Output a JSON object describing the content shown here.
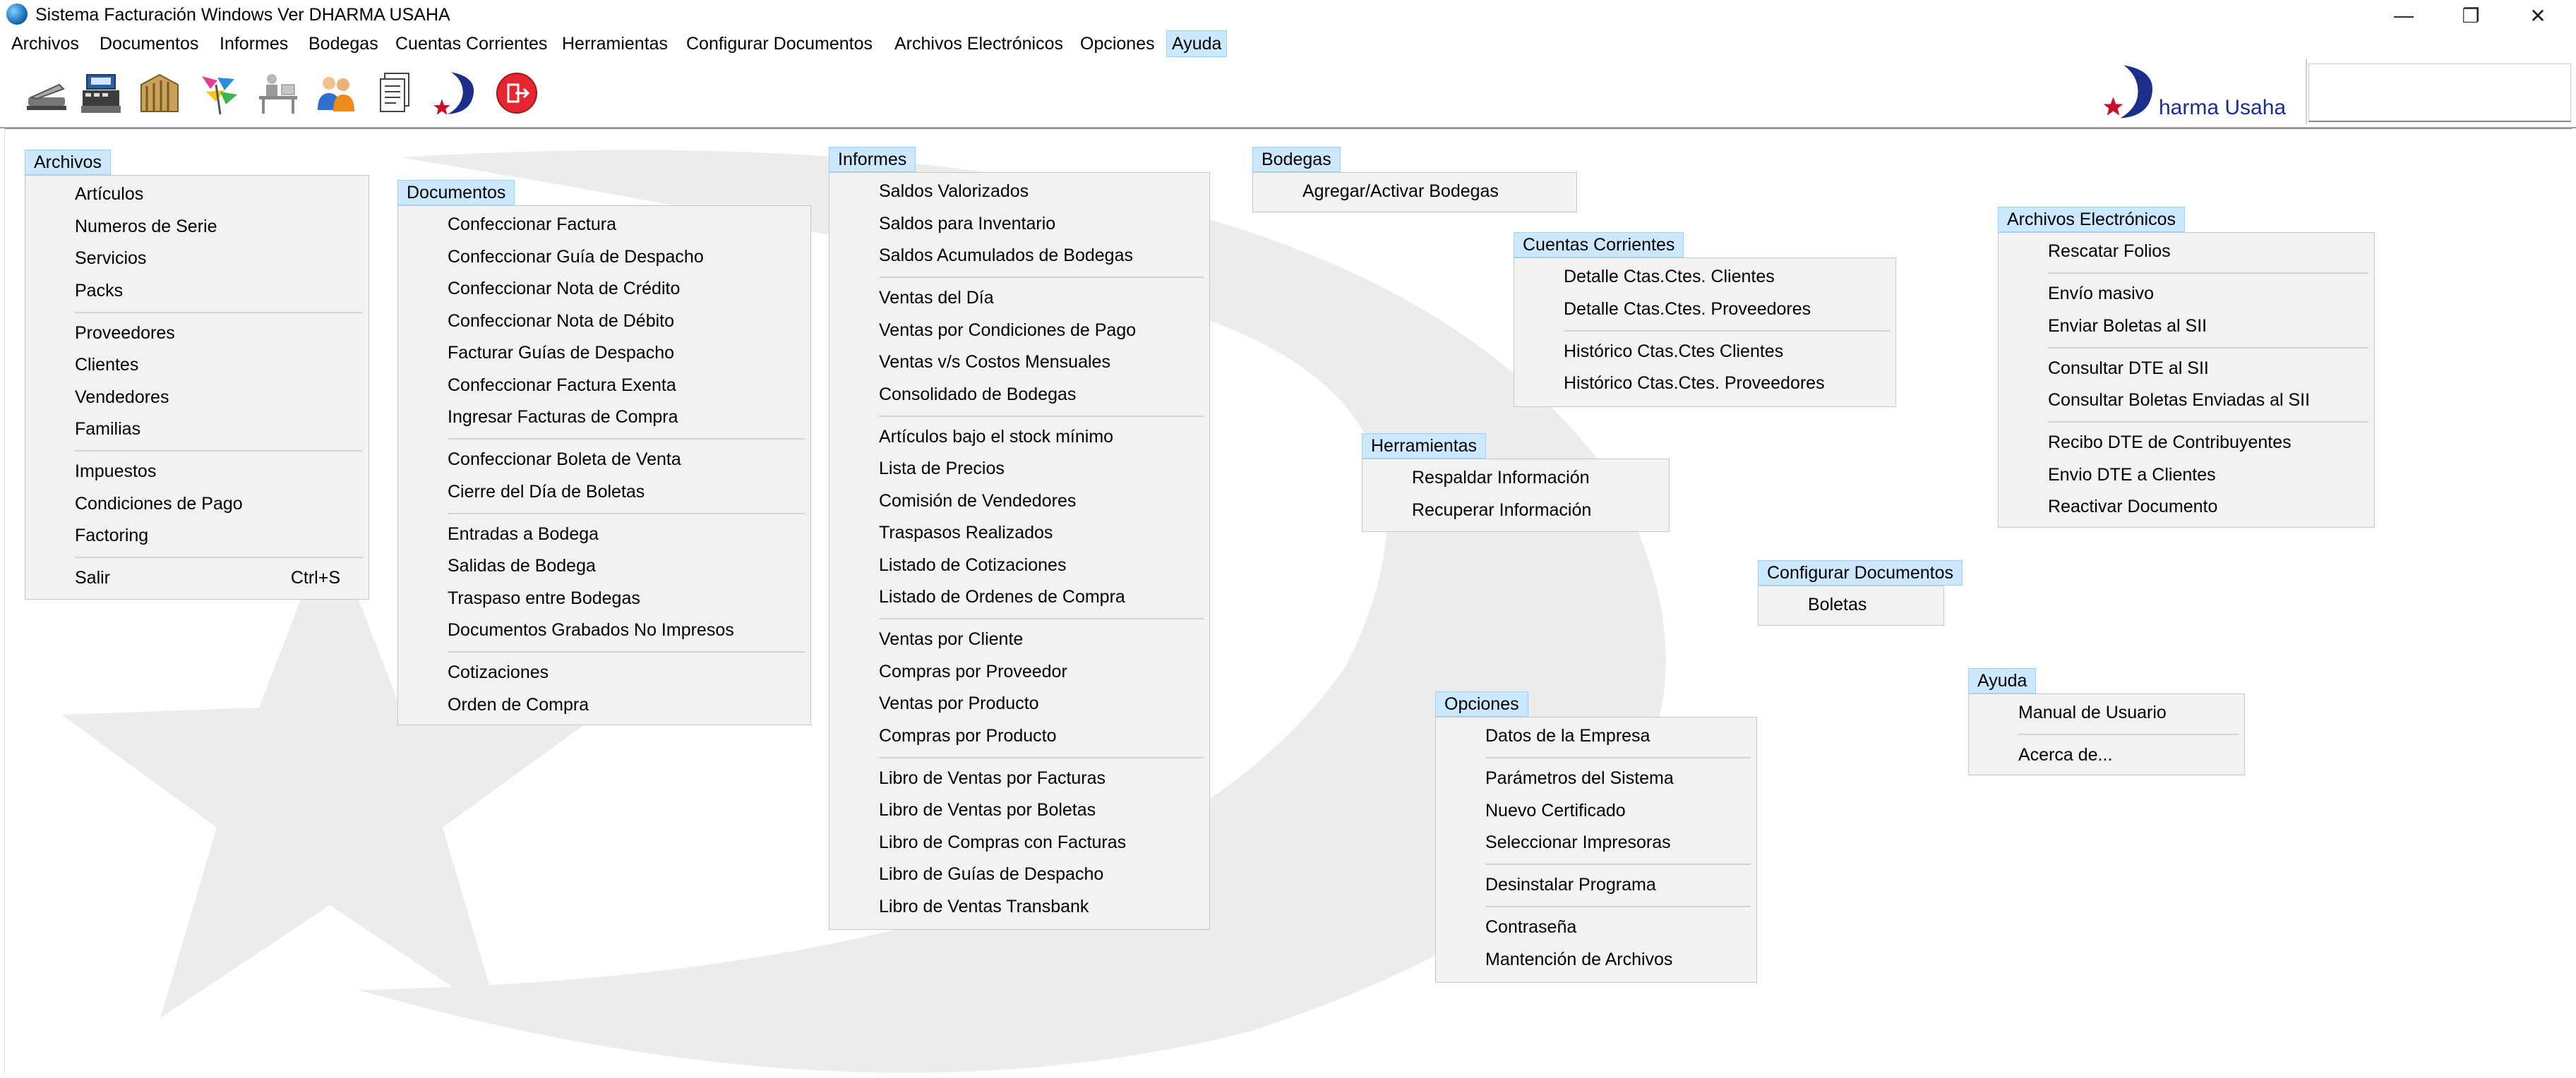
{
  "window": {
    "title": "Sistema Facturación Windows Ver DHARMA USAHA",
    "minimize_glyph": "—",
    "restore_glyph": "❐",
    "close_glyph": "✕"
  },
  "menubar": [
    "Archivos",
    "Documentos",
    "Informes",
    "Bodegas",
    "Cuentas Corrientes",
    "Herramientas",
    "Configurar Documentos",
    "Archivos Electrónicos",
    "Opciones",
    "Ayuda"
  ],
  "toolbar": {
    "icons": [
      "stapler-icon",
      "cash-register-icon",
      "warehouse-icon",
      "flags-icon",
      "desk-worker-icon",
      "users-icon",
      "documents-icon",
      "dharma-logo-icon",
      "exit-icon"
    ],
    "logo_text": "harma Usaha"
  },
  "menus": {
    "archivos": {
      "title": "Archivos",
      "items": [
        "Artículos",
        "Numeros de Serie",
        "Servicios",
        "Packs",
        "Proveedores",
        "Clientes",
        "Vendedores",
        "Familias",
        "Impuestos",
        "Condiciones de Pago",
        "Factoring",
        "Salir"
      ],
      "shortcut": "Ctrl+S"
    },
    "documentos": {
      "title": "Documentos",
      "items": [
        "Confeccionar Factura",
        "Confeccionar Guía de Despacho",
        "Confeccionar Nota de Crédito",
        "Confeccionar Nota de Débito",
        "Facturar Guías de Despacho",
        "Confeccionar Factura Exenta",
        "Ingresar Facturas de Compra",
        "Confeccionar Boleta de Venta",
        "Cierre del Día de Boletas",
        "Entradas a Bodega",
        "Salidas de Bodega",
        "Traspaso entre Bodegas",
        "Documentos Grabados No Impresos",
        "Cotizaciones",
        "Orden de Compra"
      ]
    },
    "informes": {
      "title": "Informes",
      "items": [
        "Saldos Valorizados",
        "Saldos para Inventario",
        "Saldos Acumulados de Bodegas",
        "Ventas del Día",
        "Ventas por Condiciones de Pago",
        "Ventas v/s Costos Mensuales",
        "Consolidado de Bodegas",
        "Artículos bajo el stock mínimo",
        "Lista de Precios",
        "Comisión de Vendedores",
        "Traspasos Realizados",
        "Listado de Cotizaciones",
        "Listado de Ordenes de Compra",
        "Ventas por Cliente",
        "Compras por Proveedor",
        "Ventas por Producto",
        "Compras por Producto",
        "Libro de Ventas por Facturas",
        "Libro de Ventas por Boletas",
        "Libro de Compras con Facturas",
        "Libro de Guías de Despacho",
        "Libro de Ventas Transbank"
      ]
    },
    "bodegas": {
      "title": "Bodegas",
      "items": [
        "Agregar/Activar Bodegas"
      ]
    },
    "cuentas": {
      "title": "Cuentas Corrientes",
      "items": [
        "Detalle Ctas.Ctes. Clientes",
        "Detalle Ctas.Ctes. Proveedores",
        "Histórico Ctas.Ctes Clientes",
        "Histórico Ctas.Ctes. Proveedores"
      ]
    },
    "herramientas": {
      "title": "Herramientas",
      "items": [
        "Respaldar Información",
        "Recuperar Información"
      ]
    },
    "configurar": {
      "title": "Configurar Documentos",
      "items": [
        "Boletas"
      ]
    },
    "electronicos": {
      "title": "Archivos Electrónicos",
      "items": [
        "Rescatar Folios",
        "Envío masivo",
        "Enviar Boletas al SII",
        "Consultar DTE al SII",
        "Consultar Boletas Enviadas al SII",
        "Recibo DTE de  Contribuyentes",
        "Envio DTE a Clientes",
        "Reactivar Documento"
      ]
    },
    "opciones": {
      "title": "Opciones",
      "items": [
        "Datos de la Empresa",
        "Parámetros del Sistema",
        "Nuevo Certificado",
        "Seleccionar Impresoras",
        "Desinstalar Programa",
        "Contraseña",
        "Mantención de Archivos"
      ]
    },
    "ayuda": {
      "title": "Ayuda",
      "items": [
        "Manual de Usuario",
        "Acerca de..."
      ]
    }
  },
  "colors": {
    "menu_highlight": "#cce8ff",
    "menu_highlight_border": "#99d1ff",
    "dropdown_bg": "#f2f2f2",
    "watermark": "#ececec",
    "logo_blue": "#1b2f8a",
    "logo_red": "#c8102e"
  }
}
